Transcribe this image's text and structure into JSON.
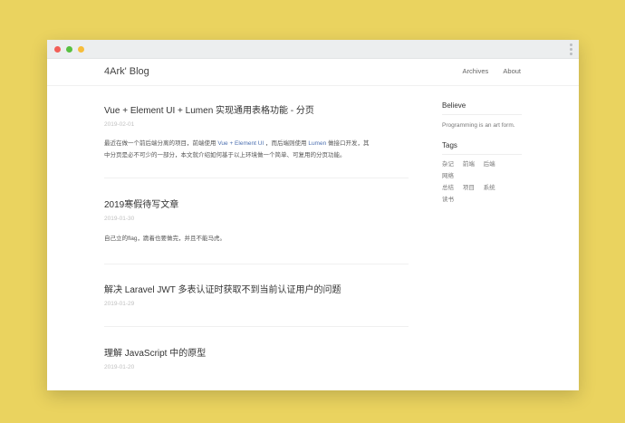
{
  "site": {
    "brand": "4Ark' Blog"
  },
  "nav": {
    "items": [
      "Archives",
      "About"
    ]
  },
  "posts": [
    {
      "title": "Vue + Element UI + Lumen 实现通用表格功能 - 分页",
      "date": "2019-02-01",
      "excerpt": {
        "p1": "最近在做一个前后端分离的项目，前端使用",
        "hl1": "Vue + Element UI",
        "p2": "，而后端则使用",
        "hl2": "Lumen",
        "p3": "做接口开发，其",
        "line2": "中分页是必不可少的一部分，本文就介绍如何基于以上环境做一个简单、可复用的分页功能。"
      }
    },
    {
      "title": "2019寒假待写文章",
      "date": "2019-01-30",
      "excerpt": {
        "text": "自己立的flag，跪着也要做完，并且不能马虎。"
      }
    },
    {
      "title": "解决 Laravel JWT 多表认证时获取不到当前认证用户的问题",
      "date": "2019-01-29"
    },
    {
      "title": "理解 JavaScript 中的原型",
      "date": "2019-01-20"
    }
  ],
  "sidebar": {
    "believe_heading": "Believe",
    "believe_text": "Programming is an art form.",
    "tags_heading": "Tags",
    "tags": [
      "杂记",
      "前端",
      "后端",
      "网络",
      "总结",
      "项目",
      "系统",
      "读书"
    ]
  },
  "colors": {
    "background": "#ead35f",
    "link": "#4b6fb0"
  }
}
